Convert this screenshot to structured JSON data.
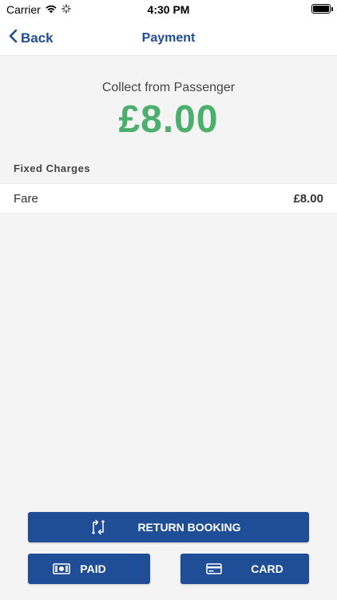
{
  "status_bar": {
    "carrier": "Carrier",
    "time": "4:30 PM"
  },
  "nav": {
    "back_label": "Back",
    "title": "Payment"
  },
  "summary": {
    "collect_label": "Collect from Passenger",
    "amount": "£8.00",
    "amount_color": "#4caf6e"
  },
  "fixed_charges": {
    "header": "Fixed Charges",
    "items": [
      {
        "label": "Fare",
        "value": "£8.00"
      }
    ]
  },
  "actions": {
    "return_booking": "RETURN BOOKING",
    "paid": "PAID",
    "card": "CARD",
    "button_color": "#1f4e96"
  },
  "icons": {
    "back": "chevron-left-icon",
    "return": "swap-arrows-icon",
    "paid": "banknote-icon",
    "card": "credit-card-icon"
  }
}
